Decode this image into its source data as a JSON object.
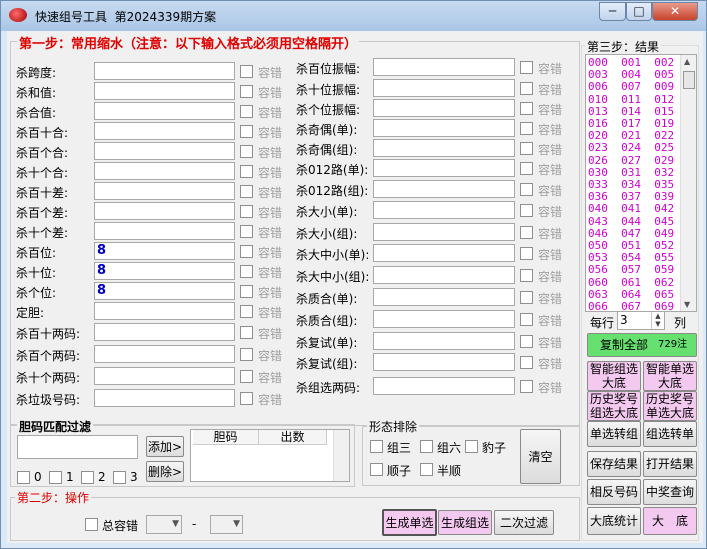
{
  "window": {
    "app_title": "快速组号工具",
    "plan": "第2024339期方案",
    "min": "─",
    "max": "□",
    "close": "✕"
  },
  "step1": {
    "legend": "第一步：常用缩水（注意：以下输入格式必须用空格隔开）",
    "checkbox_label": "容错",
    "left": [
      {
        "label": "杀跨度:",
        "value": ""
      },
      {
        "label": "杀和值:",
        "value": ""
      },
      {
        "label": "杀合值:",
        "value": ""
      },
      {
        "label": "杀百十合:",
        "value": ""
      },
      {
        "label": "杀百个合:",
        "value": ""
      },
      {
        "label": "杀十个合:",
        "value": ""
      },
      {
        "label": "杀百十差:",
        "value": ""
      },
      {
        "label": "杀百个差:",
        "value": ""
      },
      {
        "label": "杀十个差:",
        "value": ""
      },
      {
        "label": "杀百位:",
        "value": "8"
      },
      {
        "label": "杀十位:",
        "value": "8"
      },
      {
        "label": "杀个位:",
        "value": "8"
      },
      {
        "label": "定胆:",
        "value": ""
      },
      {
        "label": "杀百十两码:",
        "value": ""
      },
      {
        "label": "杀百个两码:",
        "value": ""
      },
      {
        "label": "杀十个两码:",
        "value": ""
      },
      {
        "label": "杀垃圾号码:",
        "value": ""
      }
    ],
    "right": [
      {
        "label": "杀百位振幅:",
        "value": ""
      },
      {
        "label": "杀十位振幅:",
        "value": ""
      },
      {
        "label": "杀个位振幅:",
        "value": ""
      },
      {
        "label": "杀奇偶(单):",
        "value": ""
      },
      {
        "label": "杀奇偶(组):",
        "value": ""
      },
      {
        "label": "杀012路(单):",
        "value": ""
      },
      {
        "label": "杀012路(组):",
        "value": ""
      },
      {
        "label": "杀大小(单):",
        "value": ""
      },
      {
        "label": "杀大小(组):",
        "value": ""
      },
      {
        "label": "杀大中小(单):",
        "value": ""
      },
      {
        "label": "杀大中小(组):",
        "value": ""
      },
      {
        "label": "杀质合(单):",
        "value": ""
      },
      {
        "label": "杀质合(组):",
        "value": ""
      },
      {
        "label": "杀复试(单):",
        "value": ""
      },
      {
        "label": "杀复试(组):",
        "value": ""
      },
      {
        "label": "杀组选两码:",
        "value": ""
      }
    ]
  },
  "dan": {
    "legend": "胆码匹配过滤",
    "add": "添加>",
    "del": "删除>",
    "col1": "胆码",
    "col2": "出数",
    "checks": [
      "0",
      "1",
      "2",
      "3"
    ]
  },
  "shape": {
    "legend": "形态排除",
    "items": [
      "组三",
      "组六",
      "豹子",
      "顺子",
      "半顺"
    ],
    "clear": "清空"
  },
  "step2": {
    "legend": "第二步：操作",
    "total_label": "总容错",
    "dash": "-",
    "gen_single": "生成单选",
    "gen_group": "生成组选",
    "second": "二次过滤"
  },
  "step3": {
    "legend": "第三步：结果",
    "results": "000  001  002\n003  004  005\n006  007  009\n010  011  012\n013  014  015\n016  017  019\n020  021  022\n023  024  025\n026  027  029\n030  031  032\n033  034  035\n036  037  039\n040  041  042\n043  044  045\n046  047  049\n050  051  052\n053  054  055\n056  057  059\n060  061  062\n063  064  065\n066  067  069",
    "per_row_label": "每行",
    "per_row_value": "3",
    "col_label": "列",
    "copy_all": "复制全部",
    "copy_count": "729注",
    "buttons": [
      "智能组选大底",
      "智能单选大底",
      "历史奖号组选大底",
      "历史奖号单选大底",
      "单选转组",
      "组选转单",
      "保存结果",
      "打开结果",
      "相反号码",
      "中奖查询",
      "大底统计",
      "大　底"
    ]
  }
}
